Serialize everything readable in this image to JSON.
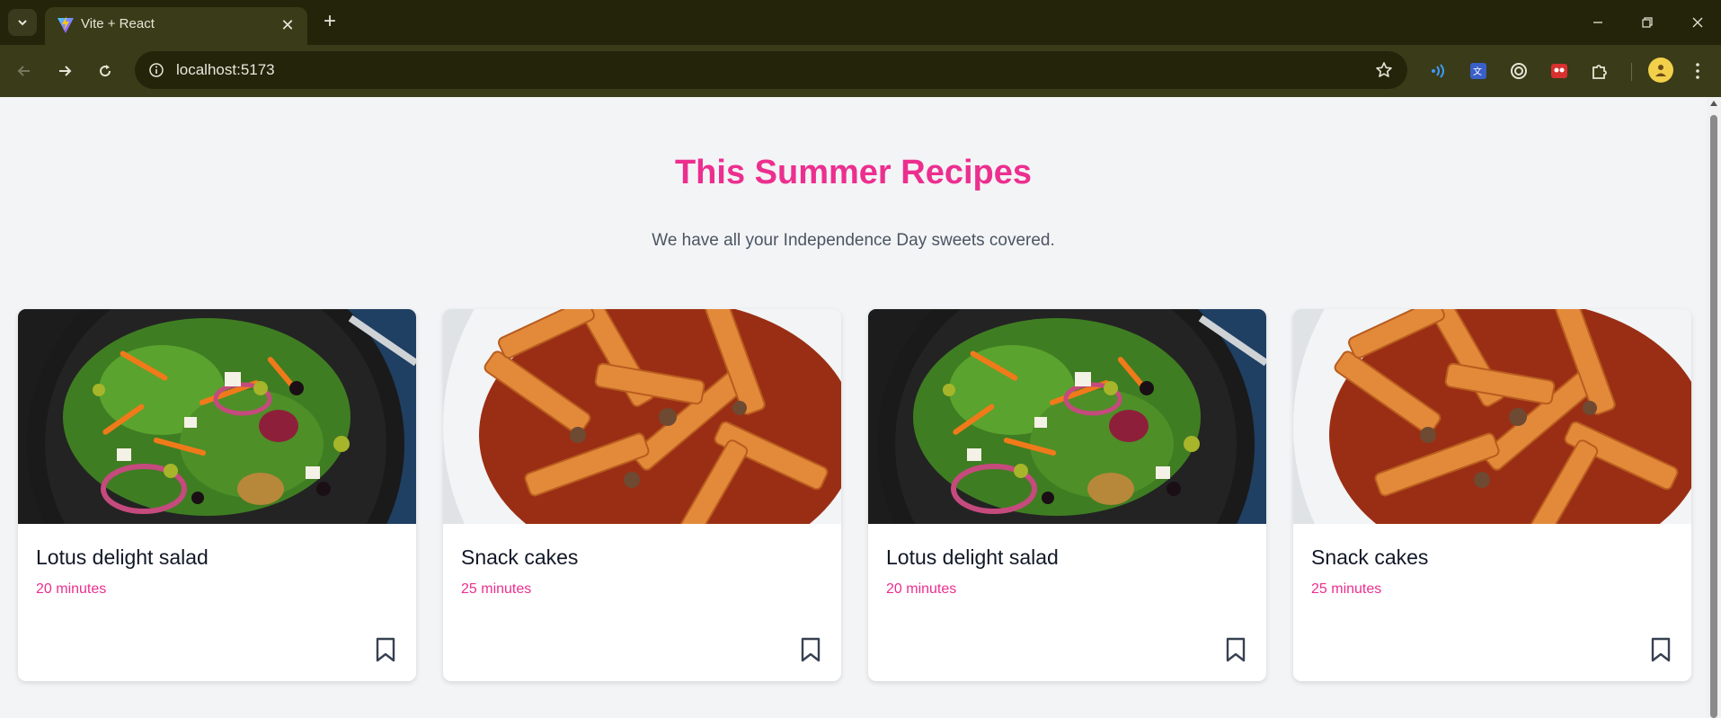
{
  "browser": {
    "tab_title": "Vite + React",
    "url": "localhost:5173",
    "icons": {
      "tab_list": "chevron-down-icon",
      "favicon": "vite-icon",
      "close_tab": "close-icon",
      "new_tab": "plus-icon",
      "back": "arrow-left-icon",
      "forward": "arrow-right-icon",
      "reload": "reload-icon",
      "site_info": "info-icon",
      "bookmark_star": "star-icon",
      "extensions": [
        "wave-icon",
        "translate-icon",
        "target-icon",
        "puzzle-red-icon",
        "puzzle-icon"
      ],
      "profile": "avatar",
      "menu": "kebab-menu-icon",
      "window": [
        "minimize-icon",
        "restore-icon",
        "close-window-icon"
      ]
    }
  },
  "page": {
    "title": "This Summer Recipes",
    "subtitle": "We have all your Independence Day sweets covered.",
    "accent_color": "#ec2f8f",
    "cards": [
      {
        "title": "Lotus delight salad",
        "time": "20 minutes",
        "image": "salad"
      },
      {
        "title": "Snack cakes",
        "time": "25 minutes",
        "image": "pasta"
      },
      {
        "title": "Lotus delight salad",
        "time": "20 minutes",
        "image": "salad"
      },
      {
        "title": "Snack cakes",
        "time": "25 minutes",
        "image": "pasta"
      }
    ]
  }
}
